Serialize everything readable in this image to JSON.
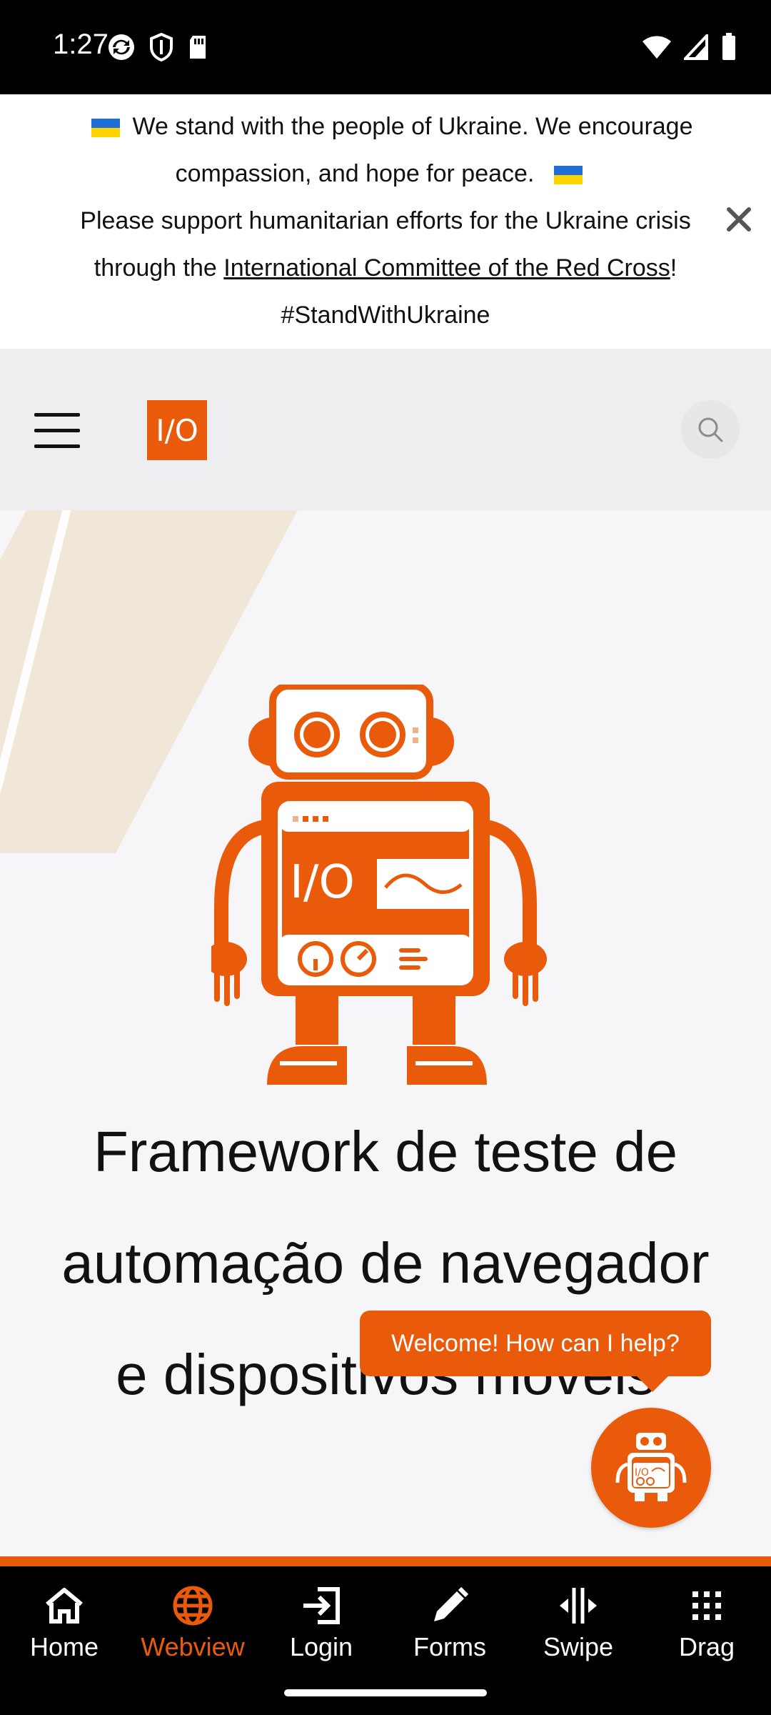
{
  "status_bar": {
    "time": "1:27",
    "icons_left": [
      "sync-icon",
      "shield-icon",
      "sd-card-icon"
    ],
    "icons_right": [
      "wifi-icon",
      "signal-icon",
      "battery-icon"
    ]
  },
  "banner": {
    "line1": "We stand with the people of Ukraine. We encourage",
    "line2": "compassion, and hope for peace.",
    "line3": "Please support humanitarian efforts for the Ukraine crisis",
    "line4_prefix": "through the ",
    "link": "International Committee of the Red Cross",
    "line4_suffix": "!",
    "line5": "#StandWithUkraine",
    "colors": {
      "flag_blue": "#1f6fd6",
      "flag_yellow": "#ffd500"
    }
  },
  "navbar": {
    "logo_text": "I/O",
    "icons": [
      "menu-icon",
      "search-icon"
    ]
  },
  "hero": {
    "headline": "Framework de teste de automação de navegador e dispositivos móveis"
  },
  "chat": {
    "tooltip": "Welcome! How can I help?"
  },
  "tabs": [
    {
      "label": "Home",
      "icon": "home-icon",
      "active": false
    },
    {
      "label": "Webview",
      "icon": "globe-icon",
      "active": true
    },
    {
      "label": "Login",
      "icon": "login-icon",
      "active": false
    },
    {
      "label": "Forms",
      "icon": "pencil-icon",
      "active": false
    },
    {
      "label": "Swipe",
      "icon": "swipe-icon",
      "active": false
    },
    {
      "label": "Drag",
      "icon": "grid-icon",
      "active": false
    }
  ],
  "colors": {
    "accent": "#ea5a0b",
    "tab_bar": "#000000"
  }
}
